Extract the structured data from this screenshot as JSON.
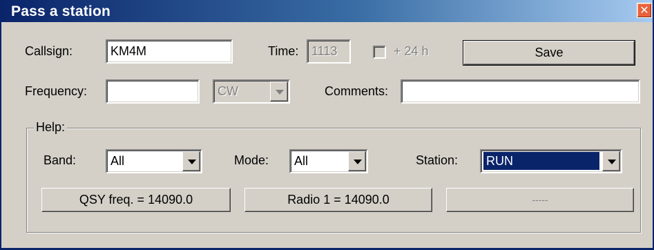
{
  "window": {
    "title": "Pass a station",
    "close_glyph": "✕"
  },
  "form": {
    "callsign_label": "Callsign:",
    "callsign_value": "KM4M",
    "time_label": "Time:",
    "time_value": "1113",
    "plus24_label": "+ 24 h",
    "save_label": "Save",
    "frequency_label": "Frequency:",
    "frequency_value": "",
    "mode_value": "CW",
    "comments_label": "Comments:",
    "comments_value": ""
  },
  "help": {
    "group_label": "Help:",
    "band_label": "Band:",
    "band_value": "All",
    "mode_label": "Mode:",
    "mode_value": "All",
    "station_label": "Station:",
    "station_value": "RUN",
    "buttons": {
      "qsy": "QSY freq. = 14090.0",
      "radio1": "Radio 1 = 14090.0",
      "empty": "-----"
    }
  },
  "icons": {
    "close": "close-icon",
    "dropdown": "chevron-down-icon"
  },
  "colors": {
    "titlebar": "#0a246a",
    "face": "#d4d0c8",
    "selection": "#0a246a",
    "close": "#e9623b"
  }
}
